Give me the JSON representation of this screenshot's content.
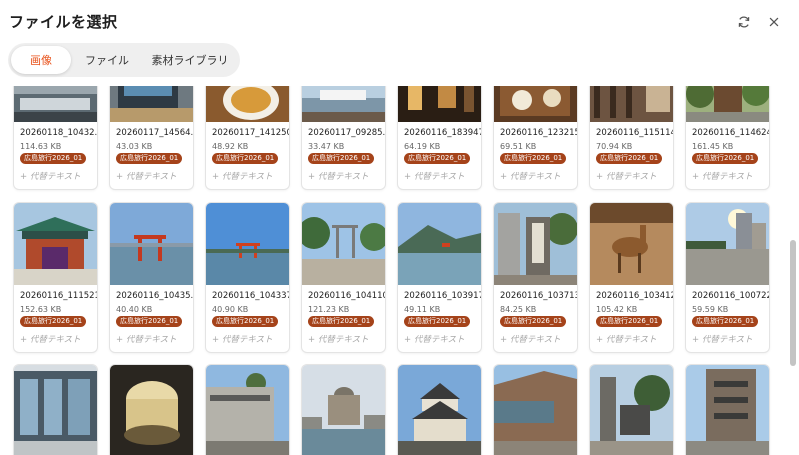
{
  "dialog": {
    "title": "ファイルを選択",
    "refresh_icon": "refresh-icon",
    "close_icon": "close-icon"
  },
  "tabs": [
    {
      "label": "画像",
      "active": true
    },
    {
      "label": "ファイル",
      "active": false
    },
    {
      "label": "素材ライブラリ",
      "active": false
    }
  ],
  "alt_text_label": "+ 代替テキスト",
  "accent_color": "#e8531c",
  "tag_color": "#a5431a",
  "rows": [
    [
      {
        "name": "20260118_10432...",
        "size": "114.63 KB",
        "tag": "広島旅行2026_01"
      },
      {
        "name": "20260117_14564...",
        "size": "43.03 KB",
        "tag": "広島旅行2026_01"
      },
      {
        "name": "20260117_141250...",
        "size": "48.92 KB",
        "tag": "広島旅行2026_01"
      },
      {
        "name": "20260117_09285...",
        "size": "33.47 KB",
        "tag": "広島旅行2026_01"
      },
      {
        "name": "20260116_183947...",
        "size": "64.19 KB",
        "tag": "広島旅行2026_01"
      },
      {
        "name": "20260116_123215...",
        "size": "69.51 KB",
        "tag": "広島旅行2026_01"
      },
      {
        "name": "20260116_115114...",
        "size": "70.94 KB",
        "tag": "広島旅行2026_01"
      },
      {
        "name": "20260116_114624...",
        "size": "161.45 KB",
        "tag": "広島旅行2026_01"
      }
    ],
    [
      {
        "name": "20260116_111521...",
        "size": "152.63 KB",
        "tag": "広島旅行2026_01"
      },
      {
        "name": "20260116_10435...",
        "size": "40.40 KB",
        "tag": "広島旅行2026_01"
      },
      {
        "name": "20260116_104337...",
        "size": "40.90 KB",
        "tag": "広島旅行2026_01"
      },
      {
        "name": "20260116_104110...",
        "size": "121.23 KB",
        "tag": "広島旅行2026_01"
      },
      {
        "name": "20260116_103917...",
        "size": "49.11 KB",
        "tag": "広島旅行2026_01"
      },
      {
        "name": "20260116_103713...",
        "size": "84.25 KB",
        "tag": "広島旅行2026_01"
      },
      {
        "name": "20260116_103412...",
        "size": "105.42 KB",
        "tag": "広島旅行2026_01"
      },
      {
        "name": "20260116_100722...",
        "size": "59.59 KB",
        "tag": "広島旅行2026_01"
      }
    ],
    [
      {
        "name": "",
        "size": "",
        "tag": ""
      },
      {
        "name": "",
        "size": "",
        "tag": ""
      },
      {
        "name": "",
        "size": "",
        "tag": ""
      },
      {
        "name": "",
        "size": "",
        "tag": ""
      },
      {
        "name": "",
        "size": "",
        "tag": ""
      },
      {
        "name": "",
        "size": "",
        "tag": ""
      },
      {
        "name": "",
        "size": "",
        "tag": ""
      },
      {
        "name": "",
        "size": "",
        "tag": ""
      }
    ]
  ]
}
